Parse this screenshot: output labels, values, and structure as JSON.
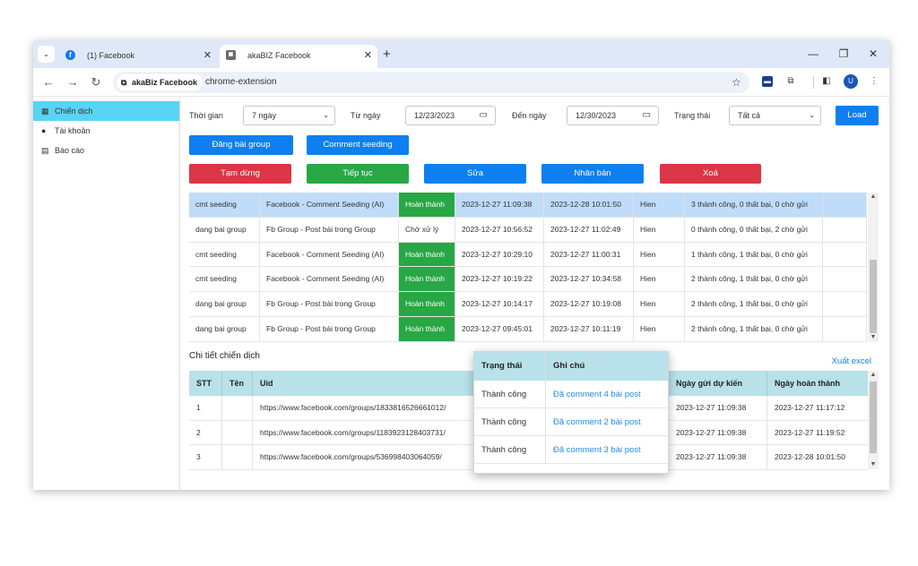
{
  "browser": {
    "tabs": [
      {
        "label": "(1) Facebook",
        "close": "✕"
      },
      {
        "label": "akaBIZ Facebook",
        "close": "✕"
      }
    ],
    "tab_menu_icon": "chevron-down-icon",
    "new_tab": "+",
    "window_controls": {
      "minimize": "—",
      "maximize": "❐",
      "close": "✕"
    },
    "nav": {
      "back": "←",
      "forward": "→",
      "reload": "↻"
    },
    "site_chip": "akaBiz Facebook",
    "url": "chrome-extension",
    "star": "☆",
    "avatar": "U",
    "menu": "⋮"
  },
  "sidebar": {
    "items": [
      {
        "label": "Chiến dịch",
        "icon": "calendar-icon",
        "active": true
      },
      {
        "label": "Tài khoản",
        "icon": "facebook-icon",
        "active": false
      },
      {
        "label": "Báo cáo",
        "icon": "report-icon",
        "active": false
      }
    ]
  },
  "filters": {
    "time_label": "Thời gian",
    "time_value": "7 ngày",
    "from_label": "Từ ngày",
    "from_value": "12/23/2023",
    "to_label": "Đến ngày",
    "to_value": "12/30/2023",
    "status_label": "Trạng thái",
    "status_value": "Tất cả",
    "load_label": "Load"
  },
  "actions": {
    "post_group": "Đăng bài group",
    "comment_seeding": "Comment seeding",
    "pause": "Tạm dừng",
    "resume": "Tiếp tục",
    "edit": "Sửa",
    "duplicate": "Nhân bản",
    "delete": "Xoá"
  },
  "campaigns": [
    {
      "name": "cmt seeding",
      "type": "Facebook - Comment Seeding (AI)",
      "status": "Hoàn thành",
      "start": "2023-12-27 11:09:38",
      "end": "2023-12-28 10:01:50",
      "visibility": "Hien",
      "result": "3 thành công, 0 thất bại, 0 chờ gửi",
      "done": true,
      "selected": true
    },
    {
      "name": "dang bai group",
      "type": "Fb Group - Post bài trong Group",
      "status": "Chờ xử lý",
      "start": "2023-12-27 10:56:52",
      "end": "2023-12-27 11:02:49",
      "visibility": "Hien",
      "result": "0 thành công, 0 thất bại, 2 chờ gửi",
      "done": false,
      "selected": false
    },
    {
      "name": "cmt seeding",
      "type": "Facebook - Comment Seeding (AI)",
      "status": "Hoàn thành",
      "start": "2023-12-27 10:29:10",
      "end": "2023-12-27 11:00:31",
      "visibility": "Hien",
      "result": "1 thành công, 1 thất bại, 0 chờ gửi",
      "done": true,
      "selected": false
    },
    {
      "name": "cmt seeding",
      "type": "Facebook - Comment Seeding (AI)",
      "status": "Hoàn thành",
      "start": "2023-12-27 10:19:22",
      "end": "2023-12-27 10:34:58",
      "visibility": "Hien",
      "result": "2 thành công, 1 thất bại, 0 chờ gửi",
      "done": true,
      "selected": false
    },
    {
      "name": "dang bai group",
      "type": "Fb Group - Post bài trong Group",
      "status": "Hoàn thành",
      "start": "2023-12-27 10:14:17",
      "end": "2023-12-27 10:19:08",
      "visibility": "Hien",
      "result": "2 thành công, 1 thất bại, 0 chờ gửi",
      "done": true,
      "selected": false
    },
    {
      "name": "dang bai group",
      "type": "Fb Group - Post bài trong Group",
      "status": "Hoàn thành",
      "start": "2023-12-27 09:45:01",
      "end": "2023-12-27 10:11:19",
      "visibility": "Hien",
      "result": "2 thành công, 1 thất bại, 0 chờ gửi",
      "done": true,
      "selected": false
    }
  ],
  "details": {
    "title": "Chi tiết chiến dịch",
    "export": "Xuất excel",
    "columns": {
      "stt": "STT",
      "name": "Tên",
      "uid": "Uid",
      "planned": "Ngày gửi dự kiến",
      "completed": "Ngày hoàn thành"
    },
    "rows": [
      {
        "stt": "1",
        "name": "",
        "uid": "https://www.facebook.com/groups/1833816526661012/",
        "planned": "2023-12-27 11:09:38",
        "completed": "2023-12-27 11:17:12"
      },
      {
        "stt": "2",
        "name": "",
        "uid": "https://www.facebook.com/groups/1183923128403731/",
        "planned": "2023-12-27 11:09:38",
        "completed": "2023-12-27 11:19:52"
      },
      {
        "stt": "3",
        "name": "",
        "uid": "https://www.facebook.com/groups/536998403064059/",
        "planned": "2023-12-27 11:09:38",
        "completed": "2023-12-28 10:01:50"
      }
    ]
  },
  "popup": {
    "columns": {
      "status": "Trạng thái",
      "note": "Ghi chú"
    },
    "rows": [
      {
        "status": "Thành công",
        "note": "Đã comment 4 bài post"
      },
      {
        "status": "Thành công",
        "note": "Đã comment 2 bài post"
      },
      {
        "status": "Thành công",
        "note": "Đã comment 3 bài post"
      }
    ]
  },
  "colors": {
    "accent": "#0d7ff0",
    "active_nav": "#58d5f4",
    "done": "#28a745",
    "danger": "#dc3545",
    "header": "#b9e1ea",
    "selected_row": "#bfdcf9"
  }
}
